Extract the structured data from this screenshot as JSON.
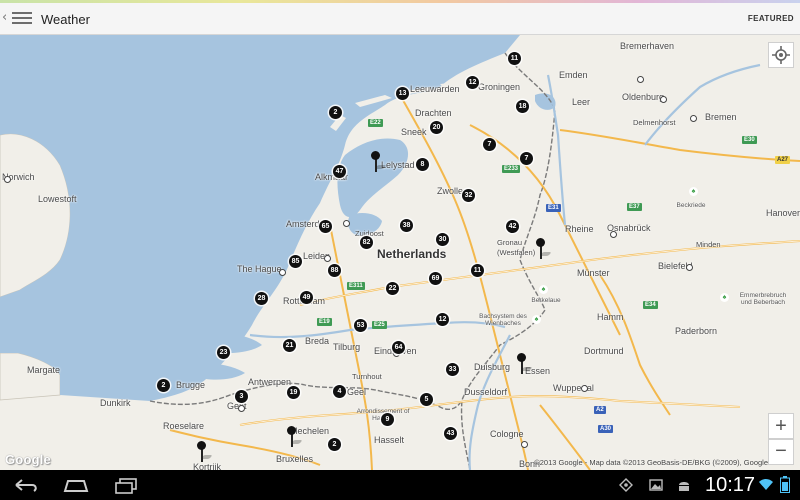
{
  "app": {
    "title": "Weather",
    "featured_label": "FEATURED",
    "accent_colors": [
      "#c9e3a8",
      "#e9e79a",
      "#f2c9a0",
      "#e2b6d6",
      "#c9d2ee"
    ]
  },
  "map": {
    "country_label": "Netherlands",
    "colors": {
      "sea": "#a6c4df",
      "land": "#f1efe9",
      "water_body": "#a6c4df",
      "motorway": "#f3b84c",
      "border": "#7a7a7a",
      "marker": "#111111"
    },
    "cities": [
      "Bremerhaven",
      "Emden",
      "Oldenburg",
      "Leer",
      "Delmenhorst",
      "Bremen",
      "Leeuwarden",
      "Groningen",
      "Drachten",
      "Sneek",
      "Alkmaar",
      "Lelystad",
      "Zwolle",
      "Amsterdam",
      "Zuidoost",
      "Leiden",
      "The Hague",
      "Rotterdam",
      "Breda",
      "Eindhoven",
      "Tilburg",
      "Antwerpen",
      "Gent",
      "Brugge",
      "Roeselare",
      "Kortrijk",
      "Mechelen",
      "Bruxelles",
      "Geel",
      "Hasselt",
      "Turnhout",
      "Arrondissement of Hasselt",
      "Duisburg",
      "Essen",
      "Dortmund",
      "Wuppertal",
      "Dusseldorf",
      "Cologne",
      "Bonn",
      "Rheine",
      "Osnabrück",
      "Bielefeld",
      "Münster",
      "Hamm",
      "Paderborn",
      "Minden",
      "Hanover",
      "Norwich",
      "Lowestoft",
      "Margate",
      "Dunkirk",
      "Gronau (Westfalen)",
      "Berkelaue",
      "Beckriede",
      "Bachsystem des Wienbaches",
      "Emmerbrebruch und Beberbach"
    ],
    "parks": [
      "Beckriede",
      "Berkelaue",
      "Emmerbrebruch und Beberbach"
    ],
    "road_shields": [
      "E22",
      "E233",
      "E31",
      "E37",
      "E30",
      "E34",
      "E311",
      "E19",
      "E25",
      "A27",
      "A2",
      "A30"
    ],
    "station_counts": [
      "11",
      "12",
      "13",
      "2",
      "18",
      "20",
      "7",
      "7",
      "8",
      "47",
      "32",
      "65",
      "38",
      "82",
      "42",
      "30",
      "85",
      "88",
      "11",
      "69",
      "22",
      "28",
      "49",
      "53",
      "12",
      "21",
      "23",
      "64",
      "33",
      "2",
      "3",
      "19",
      "4",
      "5",
      "9",
      "2",
      "43"
    ],
    "weather_pins": 5,
    "attribution": "©2013 Google - Map data ©2013 GeoBasis-DE/BKG (©2009), Google",
    "logo": "Google",
    "zoom_in": "+",
    "zoom_out": "−"
  },
  "status_bar": {
    "time": "10:17"
  },
  "icons": [
    "menu-icon",
    "locate-icon",
    "back-icon",
    "home-icon",
    "recent-apps-icon",
    "gps-icon",
    "gallery-icon",
    "android-icon",
    "wifi-icon",
    "battery-icon"
  ]
}
